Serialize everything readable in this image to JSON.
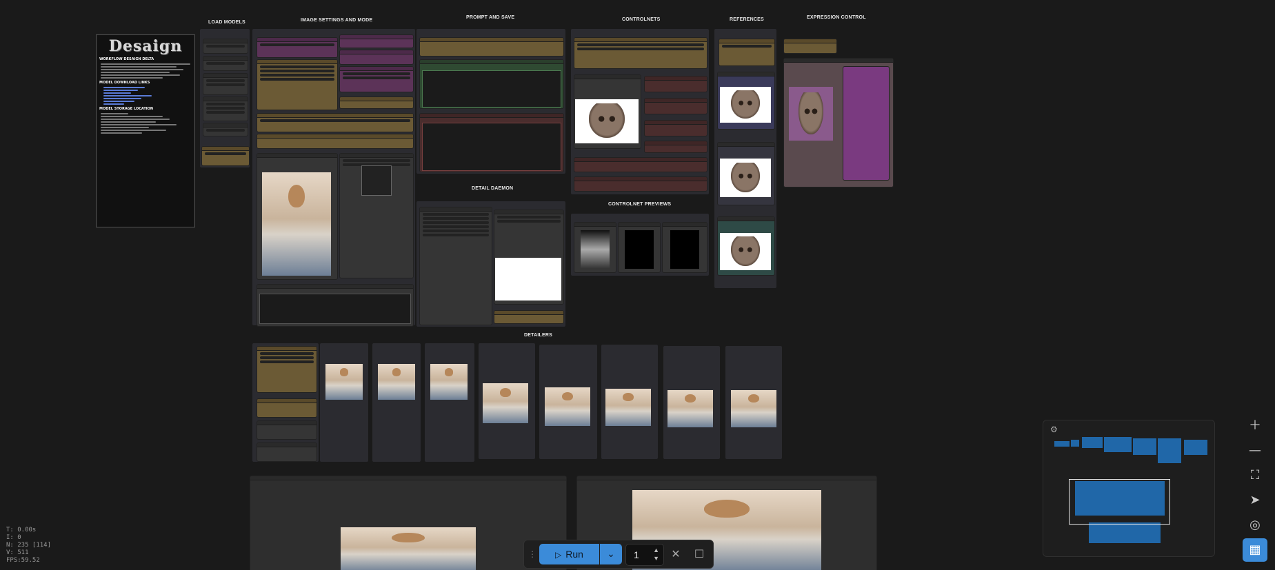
{
  "groups": {
    "load_models": "LOAD MODELS",
    "image_settings": "IMAGE SETTINGS AND MODE",
    "prompt_save": "PROMPT AND SAVE",
    "controlnets": "CONTROLNETS",
    "references": "REFERENCES",
    "expression_control": "EXPRESSION CONTROL",
    "detail_daemon": "DETAIL DAEMON",
    "controlnet_previews": "CONTROLNET PREVIEWS",
    "detailers": "DETAILERS"
  },
  "notes": {
    "logo": "Desaign",
    "title": "WORKFLOW DESAIGN DELTA",
    "section_download": "MODEL DOWNLOAD LINKS",
    "section_storage": "MODEL STORAGE LOCATION"
  },
  "hud": {
    "time": "T: 0.00s",
    "i": "I: 0",
    "nodes": "N: 235 [114]",
    "v": "V: 511",
    "fps": "FPS:59.52"
  },
  "toolbar": {
    "run_label": "Run",
    "batch_count": "1"
  },
  "icons": {
    "run": "play-icon",
    "dropdown": "chevron-down-icon",
    "clear": "close-icon",
    "stop": "square-icon",
    "zoom_in": "plus-icon",
    "zoom_out": "minus-icon",
    "fit": "fit-view-icon",
    "select": "navigate-icon",
    "hide": "eye-off-icon",
    "minimap": "map-icon",
    "settings": "sliders-icon"
  },
  "colors": {
    "accent": "#3b8bd9",
    "background": "#1a1a1a",
    "minimap_block": "#2067a8"
  }
}
